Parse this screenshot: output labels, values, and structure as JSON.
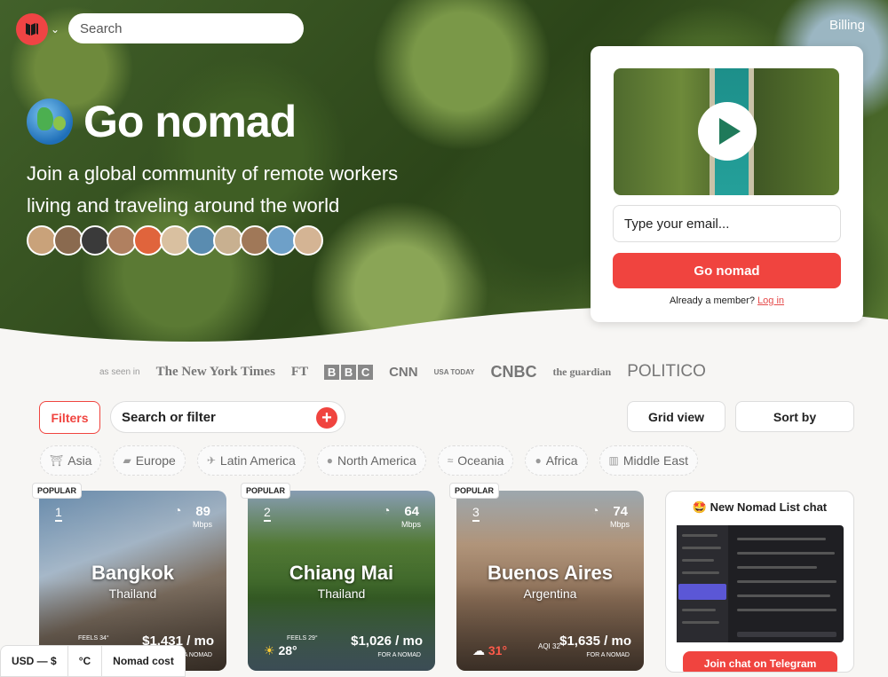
{
  "header": {
    "search_placeholder": "Search",
    "billing": "Billing"
  },
  "hero": {
    "title": "Go nomad",
    "subtitle": "Join a global community of remote workers living and traveling around the world"
  },
  "signup": {
    "email_placeholder": "Type your email...",
    "button": "Go nomad",
    "member_text": "Already a member?",
    "login": "Log in"
  },
  "press": {
    "seen": "as seen in",
    "logos": [
      "The New York Times",
      "FT",
      "BBC",
      "CNN",
      "USA TODAY",
      "CNBC",
      "the guardian",
      "POLITICO"
    ]
  },
  "toolbar": {
    "filters": "Filters",
    "search_filter": "Search or filter",
    "grid_view": "Grid view",
    "sort_by": "Sort by"
  },
  "regions": [
    {
      "label": "Asia",
      "icon": "asia-icon",
      "glyph": "⛩"
    },
    {
      "label": "Europe",
      "icon": "europe-icon",
      "glyph": "▰"
    },
    {
      "label": "Latin America",
      "icon": "latin-america-icon",
      "glyph": "✈"
    },
    {
      "label": "North America",
      "icon": "north-america-icon",
      "glyph": "●"
    },
    {
      "label": "Oceania",
      "icon": "oceania-icon",
      "glyph": "≈"
    },
    {
      "label": "Africa",
      "icon": "africa-icon",
      "glyph": "●"
    },
    {
      "label": "Middle East",
      "icon": "middle-east-icon",
      "glyph": "▥"
    }
  ],
  "cities": [
    {
      "badge": "POPULAR",
      "rank": "1",
      "name": "Bangkok",
      "country": "Thailand",
      "speed": "89",
      "unit": "Mbps",
      "feels": "FEELS 34°",
      "temp": "",
      "aqi": "",
      "cost": "$1,431 / mo",
      "for": "FOR A NOMAD",
      "bg": "linear-gradient(160deg,#7aa3c9,#b9cde0 35%,#8a7a6a 60%,#5e4e40)"
    },
    {
      "badge": "POPULAR",
      "rank": "2",
      "name": "Chiang Mai",
      "country": "Thailand",
      "speed": "64",
      "unit": "Mbps",
      "feels": "FEELS 29°",
      "temp": "28°",
      "aqi": "",
      "cost": "$1,026 / mo",
      "for": "FOR A NOMAD",
      "bg": "linear-gradient(180deg,#9fb8d1,#5d8a3c 30%,#3d6a2a 60%,#6b8a9a)"
    },
    {
      "badge": "POPULAR",
      "rank": "3",
      "name": "Buenos Aires",
      "country": "Argentina",
      "speed": "74",
      "unit": "Mbps",
      "feels": "",
      "temp": "31°",
      "aqi": "AQI 32",
      "cost": "$1,635 / mo",
      "for": "FOR A NOMAD",
      "bg": "linear-gradient(180deg,#b8c4cc,#c8a88a 30%,#9a7a60 60%,#6a5545)"
    }
  ],
  "chat": {
    "title": "🤩 New Nomad List chat",
    "button": "Join chat on Telegram"
  },
  "bottombar": {
    "currency": "USD — $",
    "unit": "°C",
    "cost": "Nomad cost"
  },
  "colors": {
    "accent": "#f0443f"
  }
}
